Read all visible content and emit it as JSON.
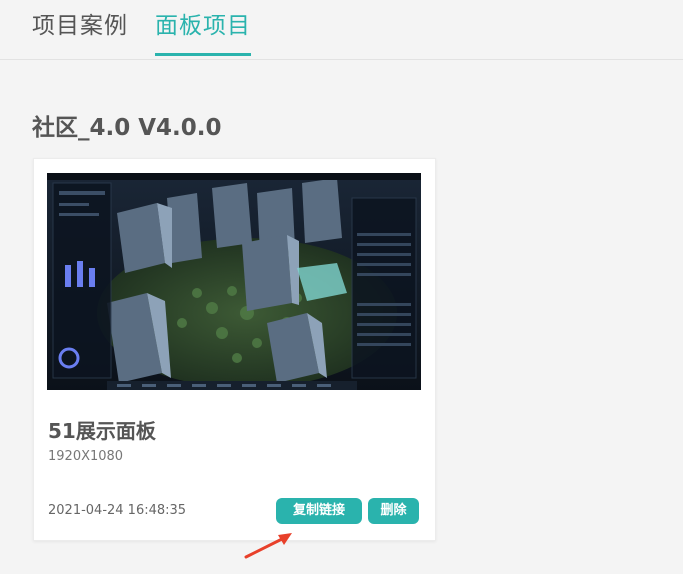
{
  "tabs": [
    {
      "label": "项目案例",
      "active": false
    },
    {
      "label": "面板项目",
      "active": true
    }
  ],
  "section": {
    "title": "社区_4.0 V4.0.0"
  },
  "card": {
    "title": "51展示面板",
    "resolution": "1920X1080",
    "updated_at": "2021-04-24 16:48:35",
    "copy_link_label": "复制链接",
    "delete_label": "删除"
  },
  "colors": {
    "accent": "#2ab3ad",
    "annotation_arrow": "#e8402a",
    "background": "#f4f4f4"
  }
}
